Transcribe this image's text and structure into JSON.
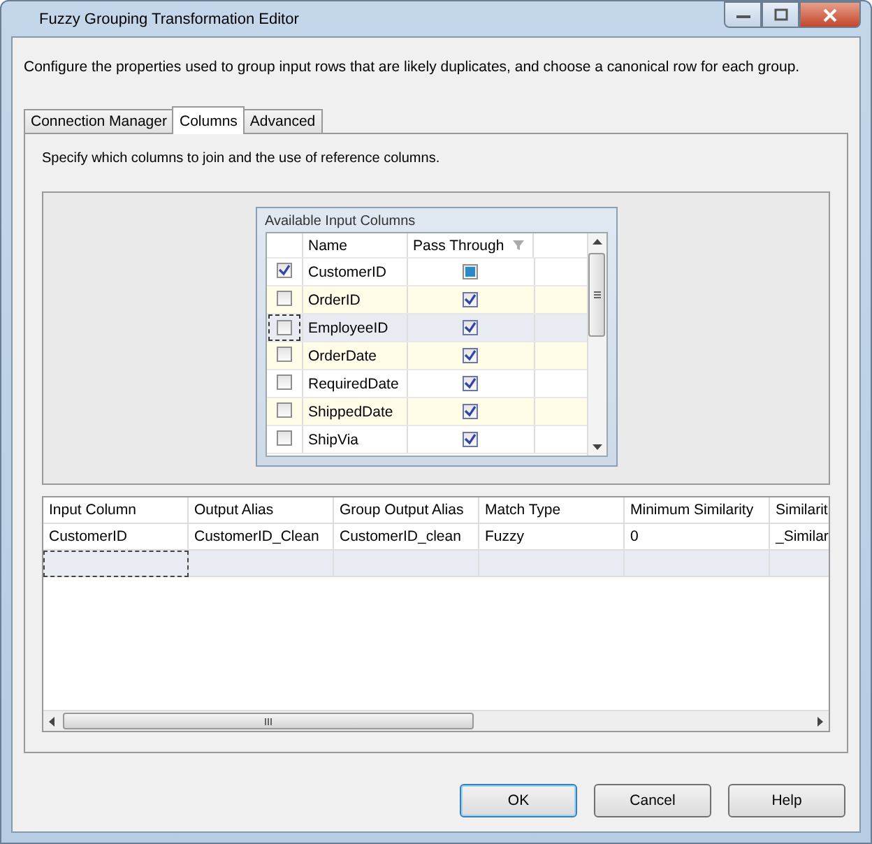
{
  "window": {
    "title": "Fuzzy Grouping Transformation Editor"
  },
  "description": "Configure the properties used to group input rows that are likely duplicates, and choose a canonical row for each group.",
  "tabs": [
    {
      "label": "Connection Manager",
      "selected": false
    },
    {
      "label": "Columns",
      "selected": true
    },
    {
      "label": "Advanced",
      "selected": false
    }
  ],
  "instructions": "Specify which columns to join and the use of reference columns.",
  "available_columns": {
    "title": "Available Input Columns",
    "columns": [
      "Name",
      "Pass Through"
    ],
    "rows": [
      {
        "checked": true,
        "name": "CustomerID",
        "pass_through": false,
        "partial": true,
        "selected": false
      },
      {
        "checked": false,
        "name": "OrderID",
        "pass_through": true,
        "partial": false,
        "selected": false
      },
      {
        "checked": false,
        "name": "EmployeeID",
        "pass_through": true,
        "partial": false,
        "selected": true
      },
      {
        "checked": false,
        "name": "OrderDate",
        "pass_through": true,
        "partial": false,
        "selected": false
      },
      {
        "checked": false,
        "name": "RequiredDate",
        "pass_through": true,
        "partial": false,
        "selected": false
      },
      {
        "checked": false,
        "name": "ShippedDate",
        "pass_through": true,
        "partial": false,
        "selected": false
      },
      {
        "checked": false,
        "name": "ShipVia",
        "pass_through": true,
        "partial": false,
        "selected": false
      }
    ]
  },
  "grid": {
    "columns": [
      "Input Column",
      "Output Alias",
      "Group Output Alias",
      "Match Type",
      "Minimum Similarity",
      "Similarit"
    ],
    "rows": [
      [
        "CustomerID",
        "CustomerID_Clean",
        "CustomerID_clean",
        "Fuzzy",
        "0",
        "_Similar"
      ]
    ]
  },
  "buttons": [
    "OK",
    "Cancel",
    "Help"
  ]
}
